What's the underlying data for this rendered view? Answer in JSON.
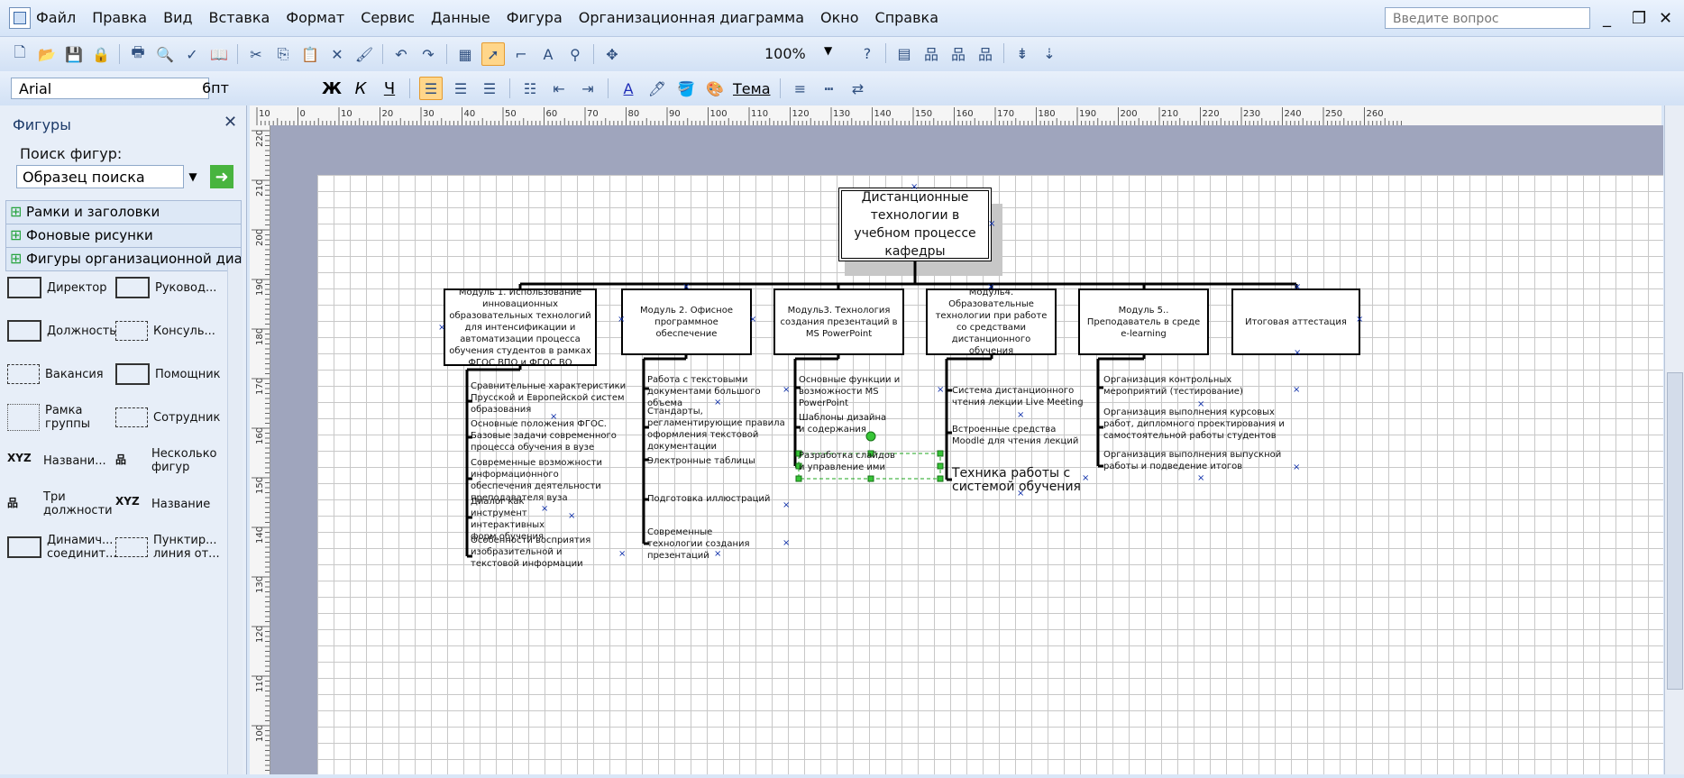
{
  "menubar": {
    "items": [
      "Файл",
      "Правка",
      "Вид",
      "Вставка",
      "Формат",
      "Сервис",
      "Данные",
      "Фигура",
      "Организационная диаграмма",
      "Окно",
      "Справка"
    ],
    "question_placeholder": "Введите вопрос"
  },
  "toolbar": {
    "zoom": "100%",
    "font": "Arial",
    "font_size": "6пт",
    "bold": "Ж",
    "italic": "К",
    "underline": "Ч",
    "theme": "Тема"
  },
  "shapes_panel": {
    "title": "Фигуры",
    "search_label": "Поиск фигур:",
    "search_placeholder": "Образец поиска",
    "stencils": [
      "Рамки и заголовки",
      "Фоновые рисунки",
      "Фигуры организационной диаг..."
    ],
    "shapes": [
      [
        "Директор",
        "Руковод..."
      ],
      [
        "Должность",
        "Консуль..."
      ],
      [
        "Вакансия",
        "Помощник"
      ],
      [
        "Рамка группы",
        "Сотрудник"
      ],
      [
        "Названи...",
        "Несколько фигур"
      ],
      [
        "Три должности",
        "Название"
      ],
      [
        "Динамич... соединит...",
        "Пунктир... линия от..."
      ]
    ]
  },
  "ruler": {
    "h": [
      "10",
      "0",
      "10",
      "20",
      "30",
      "40",
      "50",
      "60",
      "70",
      "80",
      "90",
      "100",
      "110",
      "120",
      "130",
      "140",
      "150",
      "160",
      "170",
      "180",
      "190",
      "200",
      "210",
      "220",
      "230",
      "240",
      "250",
      "260"
    ],
    "v": [
      "220",
      "210",
      "200",
      "190",
      "180",
      "170",
      "160",
      "150",
      "140",
      "130",
      "120",
      "110",
      "100"
    ]
  },
  "diagram": {
    "top": "Дистанционные технологии в учебном процессе кафедры",
    "modules": [
      {
        "title": "Модуль 1. Использование инновационных образовательных технологий для интенсификации и автоматизации процесса обучения студентов в рамках ФГОС ВПО и ФГОС ВО",
        "items": [
          "Сравнительные характеристики Прусской и Европейской систем образования",
          "Основные положения ФГОС. Базовые задачи современного процесса обучения в вузе",
          "Современные возможности информационного обеспечения деятельности преподавателя вуза",
          "Диалог как инструмент интерактивных форм обучения",
          "Особенности восприятия изобразительной и текстовой информации"
        ]
      },
      {
        "title": "Модуль 2. Офисное программное обеспечение",
        "items": [
          "Работа с текстовыми документами большого объема",
          "Стандарты, регламентирующие правила оформления текстовой документации",
          "Электронные таблицы",
          "Подготовка иллюстраций",
          "Современные технологии создания презентаций"
        ]
      },
      {
        "title": "Модуль3. Технология создания презентаций в MS PowerPoint",
        "items": [
          "Основные функции и возможности MS PowerPoint",
          "Шаблоны дизайна и содержания",
          "Разработка слайдов и управление ими"
        ]
      },
      {
        "title": "Модуль4. Образовательные технологии при работе со средствами дистанционного обучения",
        "items": [
          "Система дистанционного чтения лекции Live Meeting",
          "Встроенные средства Moodle для чтения лекций",
          "Техника работы с системой обучения"
        ]
      },
      {
        "title": "Модуль 5.. Преподаватель в среде e-learning",
        "items": [
          "Организация контрольных мероприятий (тестирование)",
          "Организация выполнения курсовых работ, дипломного проектирования и самостоятельной работы студентов",
          "Организация выполнения выпускной работы и подведение итогов"
        ]
      },
      {
        "title": "Итоговая аттестация",
        "items": []
      }
    ]
  }
}
